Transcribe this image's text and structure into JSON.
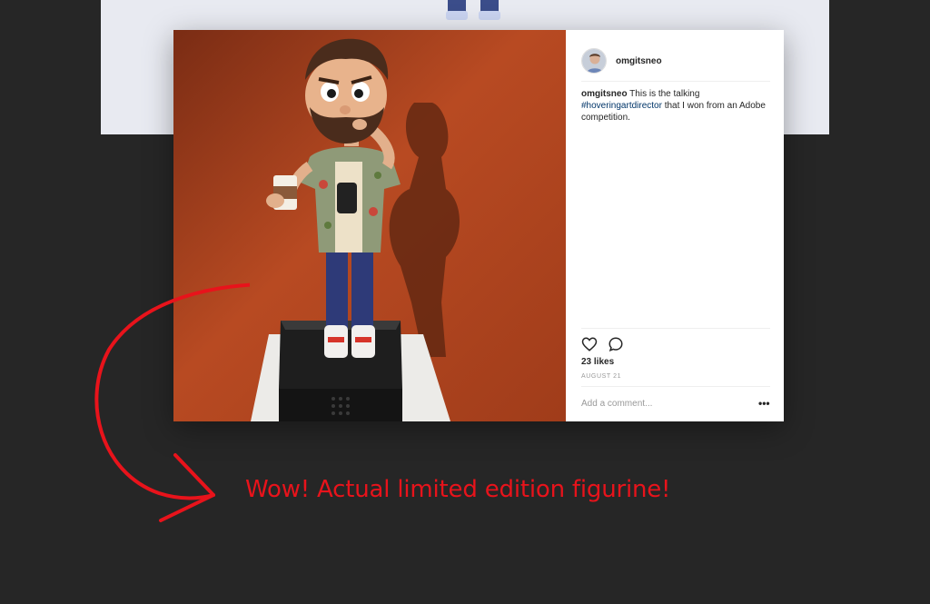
{
  "post": {
    "username": "omgitsneo",
    "caption": {
      "username": "omgitsneo",
      "text_before": "This is the talking",
      "hashtag": "#hoveringartdirector",
      "text_after": "that I won from an Adobe competition."
    },
    "likes": "23 likes",
    "date": "AUGUST 21",
    "comment_placeholder": "Add a comment...",
    "more_label": "•••"
  },
  "icons": {
    "like": "heart-icon",
    "comment": "comment-icon",
    "more": "more-options-icon"
  },
  "annotation": {
    "text": "Wow! Actual limited edition figurine!",
    "color": "#e8131b"
  },
  "colors": {
    "page_background": "#262626",
    "hashtag": "#003569",
    "photo_backdrop": "#b84a22"
  }
}
